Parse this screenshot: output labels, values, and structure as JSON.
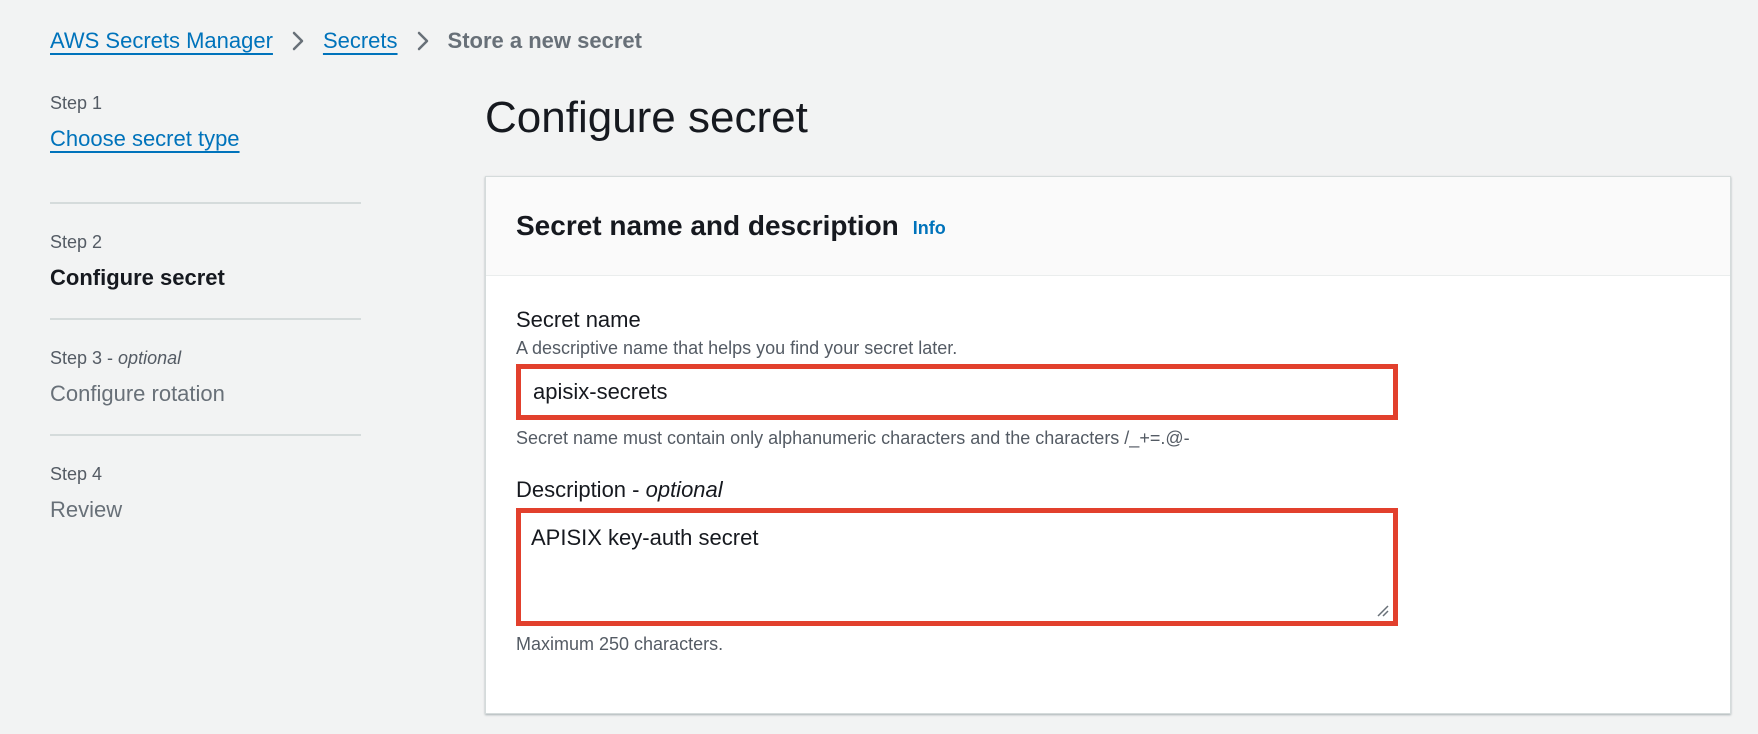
{
  "breadcrumb": {
    "items": [
      "AWS Secrets Manager",
      "Secrets"
    ],
    "current": "Store a new secret"
  },
  "steps": [
    {
      "number": "Step 1",
      "optional": "",
      "title": "Choose secret type",
      "state": "link"
    },
    {
      "number": "Step 2",
      "optional": "",
      "title": "Configure secret",
      "state": "active"
    },
    {
      "number": "Step 3 - ",
      "optional": "optional",
      "title": "Configure rotation",
      "state": "disabled"
    },
    {
      "number": "Step 4",
      "optional": "",
      "title": "Review",
      "state": "disabled"
    }
  ],
  "page": {
    "title": "Configure secret"
  },
  "panel": {
    "title": "Secret name and description",
    "info": "Info",
    "secret_name": {
      "label": "Secret name",
      "description": "A descriptive name that helps you find your secret later.",
      "value": "apisix-secrets",
      "constraint": "Secret name must contain only alphanumeric characters and the characters /_+=.@-"
    },
    "description": {
      "label": "Description - ",
      "label_optional": "optional",
      "value": "APISIX key-auth secret",
      "constraint": "Maximum 250 characters."
    }
  },
  "colors": {
    "link": "#0073bb",
    "highlight_border": "#e2402d",
    "background": "#f2f3f3"
  },
  "icons": {
    "breadcrumb_separator": "chevron-right-icon",
    "textarea_resize": "resize-handle-icon"
  }
}
